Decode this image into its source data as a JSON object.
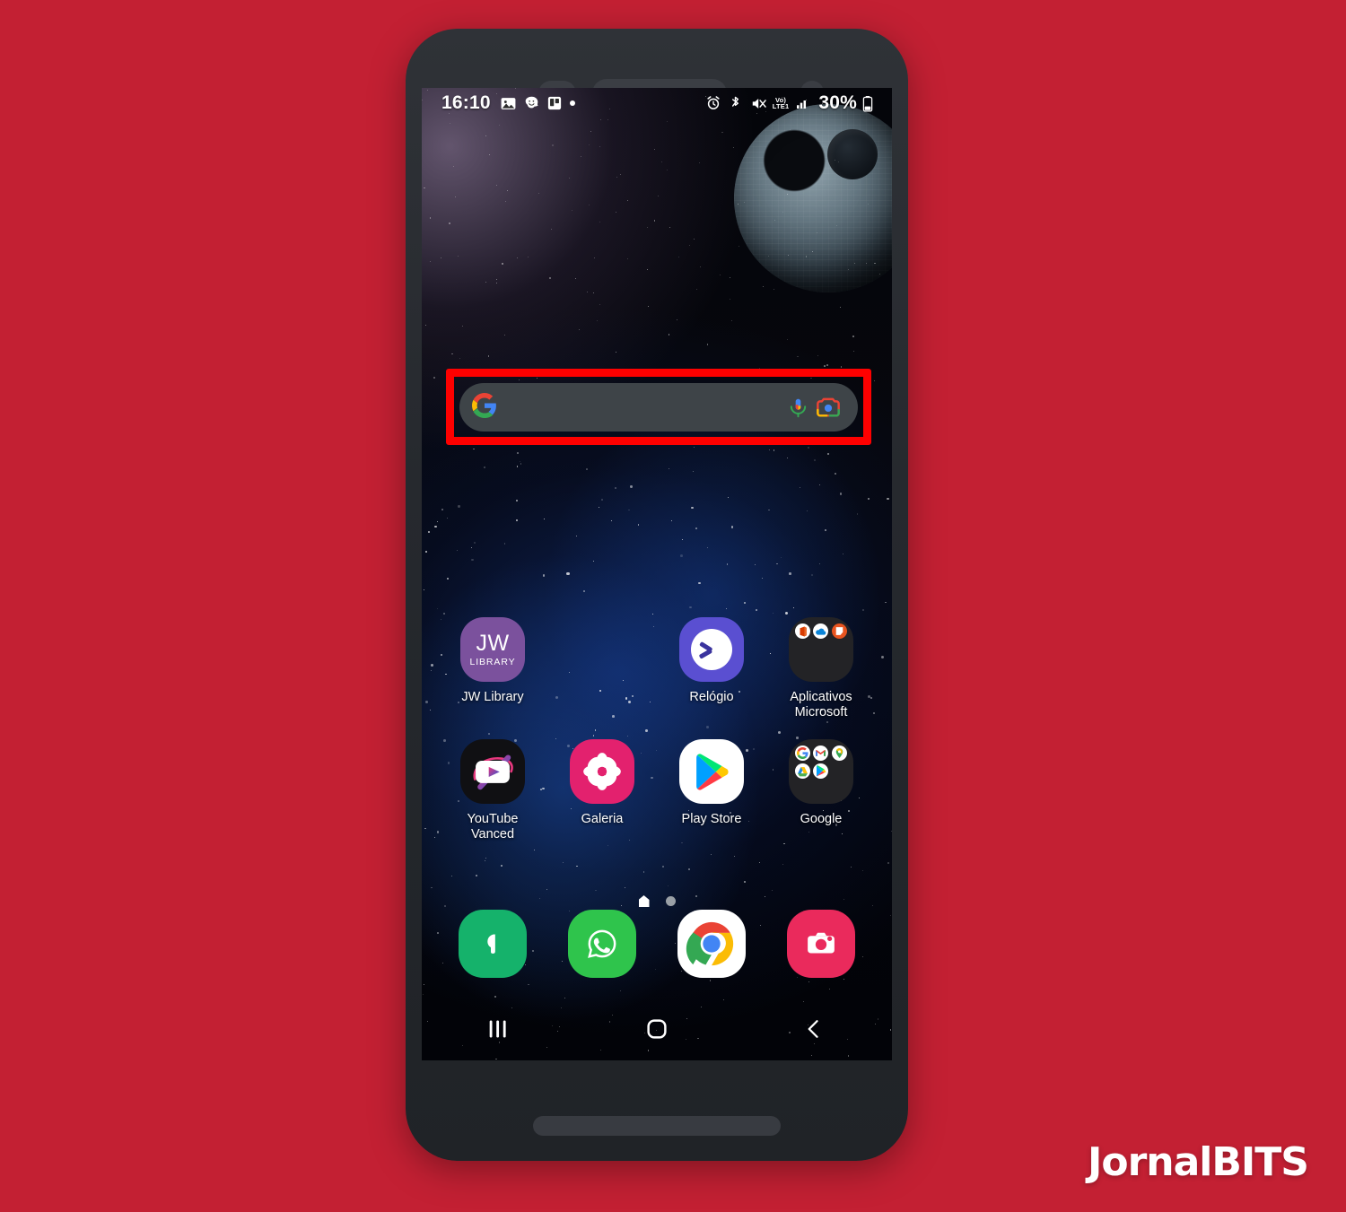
{
  "page": {
    "background_color": "#c32033",
    "watermark": "JornalBITS"
  },
  "status_bar": {
    "clock": "16:10",
    "battery_percent": "30%",
    "network_label_top": "Vo)",
    "network_label_bottom": "LTE1",
    "left_icons": [
      "gallery-icon",
      "waze-icon",
      "trello-icon",
      "notification-dot"
    ],
    "right_icons": [
      "alarm-icon",
      "bluetooth-icon",
      "mute-icon",
      "volte-icon",
      "signal-icon",
      "battery-icon"
    ]
  },
  "search": {
    "value": "",
    "placeholder": "",
    "logo": "google-g-icon",
    "mic": "microphone-icon",
    "lens": "google-lens-icon",
    "highlight_color": "#fe0000"
  },
  "home_screen": {
    "rows": [
      [
        {
          "label": "JW Library",
          "icon": "jw-library-icon"
        },
        {
          "label": "",
          "icon": ""
        },
        {
          "label": "Relógio",
          "icon": "clock-icon"
        },
        {
          "label": "Aplicativos Microsoft",
          "icon": "microsoft-folder-icon"
        }
      ],
      [
        {
          "label": "YouTube Vanced",
          "icon": "youtube-vanced-icon"
        },
        {
          "label": "Galeria",
          "icon": "gallery-app-icon"
        },
        {
          "label": "Play Store",
          "icon": "play-store-icon"
        },
        {
          "label": "Google",
          "icon": "google-folder-icon"
        }
      ]
    ],
    "page_indicator": {
      "pages": 2,
      "current": 1
    }
  },
  "dock": {
    "items": [
      {
        "label": "Telefone",
        "icon": "phone-icon"
      },
      {
        "label": "WhatsApp",
        "icon": "whatsapp-icon"
      },
      {
        "label": "Chrome",
        "icon": "chrome-icon"
      },
      {
        "label": "Câmera",
        "icon": "camera-icon"
      }
    ]
  },
  "nav_bar": {
    "recents": "recents-icon",
    "home": "home-icon",
    "back": "back-icon"
  },
  "folders": {
    "microsoft": [
      "office-icon",
      "onedrive-icon",
      "sticky-notes-icon"
    ],
    "google": [
      "google-icon",
      "gmail-icon",
      "maps-icon",
      "drive-icon",
      "play-icon"
    ]
  },
  "jw": {
    "line1": "JW",
    "line2": "LIBRARY"
  }
}
